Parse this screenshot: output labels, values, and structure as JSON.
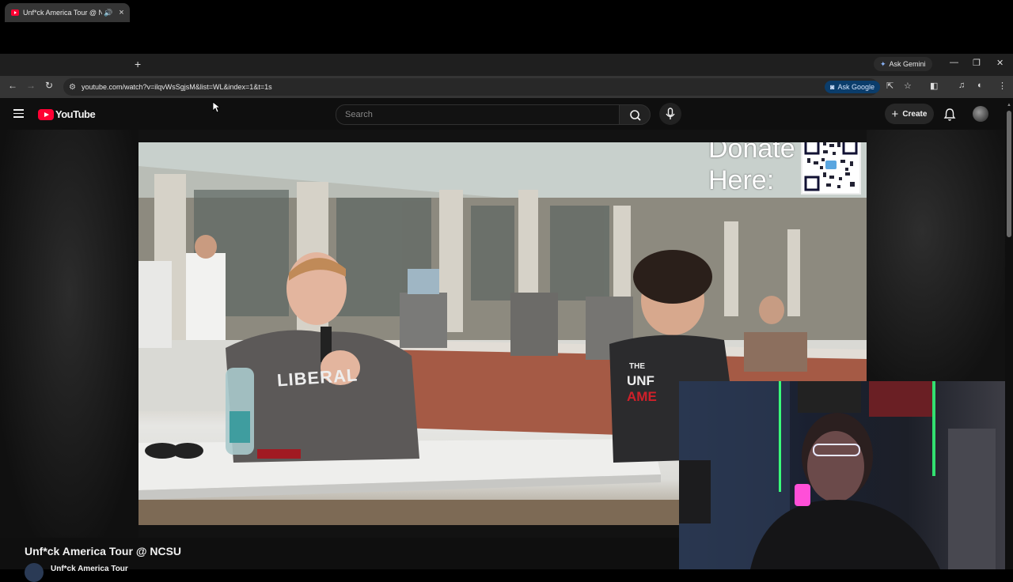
{
  "browser": {
    "tab": {
      "title": "Unf*ck America Tour @ NC",
      "icon": "youtube-favicon-icon"
    },
    "new_tab_label": "+",
    "ask_gemini": "Ask Gemini",
    "ask_google": "Ask Google",
    "url": "youtube.com/watch?v=ilqvWsSgjsM&list=WL&index=1&t=1s"
  },
  "youtube": {
    "logo_text": "YouTube",
    "search_placeholder": "Search",
    "create_label": "Create"
  },
  "video": {
    "title": "Unf*ck America Tour @ NCSU",
    "channel": "Unf*ck America Tour",
    "overlay_text_line1": "Donate",
    "overlay_text_line2": "Here:",
    "shirt_left": "LIBERAL",
    "shirt_right_1": "THE",
    "shirt_right_2": "UNF",
    "shirt_right_3": "AME"
  },
  "colors": {
    "youtube_red": "#ff0033",
    "page_bg": "#0f0f0f",
    "tab_active": "#353535"
  }
}
